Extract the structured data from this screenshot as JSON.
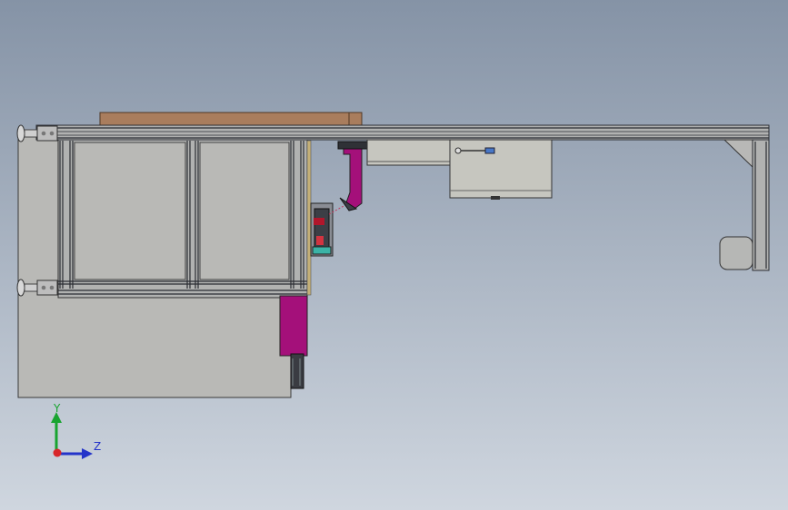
{
  "viewport": {
    "background_top": "#8593a6",
    "background_bottom": "#cfd6df"
  },
  "colors": {
    "panel_fill": "#b9b9b6",
    "frame_fill": "#b1b2b1",
    "frame_dark": "#2b2d33",
    "wood": "#a97d5d",
    "magenta": "#a4107a",
    "cabinet": "#c6c6bf",
    "x_axis": "#d8262a",
    "y_axis": "#18a430",
    "z_axis": "#2333c9"
  },
  "triad": {
    "y_label": "Y",
    "z_label": "Z"
  }
}
